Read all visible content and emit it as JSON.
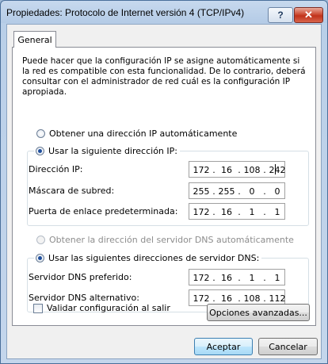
{
  "window": {
    "title": "Propiedades: Protocolo de Internet versión 4 (TCP/IPv4)",
    "help_label": "?",
    "close_label": "✕"
  },
  "tabs": [
    {
      "label": "General",
      "selected": true
    }
  ],
  "description": "Puede hacer que la configuración IP se asigne automáticamente si la red es compatible con esta funcionalidad. De lo contrario, deberá consultar con el administrador de red cuál es la configuración IP apropiada.",
  "ip_mode": {
    "auto_label": "Obtener una dirección IP automáticamente",
    "manual_label": "Usar la siguiente dirección IP:",
    "selected": "manual"
  },
  "ip_fields": [
    {
      "label": "Dirección IP:",
      "octets": [
        "172",
        "16",
        "108",
        "242"
      ]
    },
    {
      "label": "Máscara de subred:",
      "octets": [
        "255",
        "255",
        "0",
        "0"
      ]
    },
    {
      "label": "Puerta de enlace predeterminada:",
      "octets": [
        "172",
        "16",
        "1",
        "1"
      ]
    }
  ],
  "dns_mode": {
    "auto_label": "Obtener la dirección del servidor DNS automáticamente",
    "manual_label": "Usar las siguientes direcciones de servidor DNS:",
    "selected": "manual",
    "auto_disabled": true
  },
  "dns_fields": [
    {
      "label": "Servidor DNS preferido:",
      "octets": [
        "172",
        "16",
        "1",
        "1"
      ]
    },
    {
      "label": "Servidor DNS alternativo:",
      "octets": [
        "172",
        "16",
        "108",
        "112"
      ]
    }
  ],
  "validate": {
    "label": "Validar configuración al salir",
    "checked": false
  },
  "buttons": {
    "advanced": "Opciones avanzadas...",
    "ok": "Aceptar",
    "cancel": "Cancelar"
  }
}
